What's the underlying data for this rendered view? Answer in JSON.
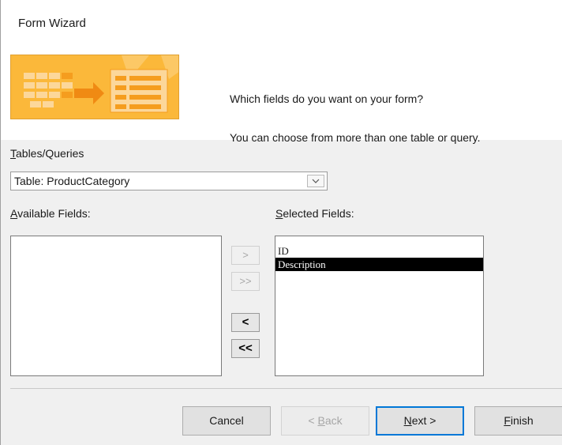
{
  "window": {
    "title": "Form Wizard"
  },
  "header": {
    "prompt_line1": "Which fields do you want on your form?",
    "prompt_line2": "You can choose from more than one table or query."
  },
  "tables_queries": {
    "label_access_key": "T",
    "label_rest": "ables/Queries",
    "selected_value": "Table: ProductCategory"
  },
  "available_fields": {
    "label_access_key": "A",
    "label_rest": "vailable Fields:",
    "items": []
  },
  "selected_fields": {
    "label_access_key": "S",
    "label_rest": "elected Fields:",
    "items": [
      {
        "label": "ID",
        "selected": false
      },
      {
        "label": "Description",
        "selected": true
      }
    ]
  },
  "move_buttons": {
    "add_one": ">",
    "add_all": ">>",
    "remove_one": "<",
    "remove_all": "<<"
  },
  "footer": {
    "cancel": "Cancel",
    "back_prefix": "< ",
    "back_access_key": "B",
    "back_rest": "ack",
    "next_access_key": "N",
    "next_rest": "ext >",
    "finish_access_key": "F",
    "finish_rest": "inish"
  },
  "colors": {
    "dialog_bg": "#f0f0f0",
    "image_orange": "#fbb83a",
    "selection_bg": "#000000",
    "default_button_border": "#0078d7"
  }
}
